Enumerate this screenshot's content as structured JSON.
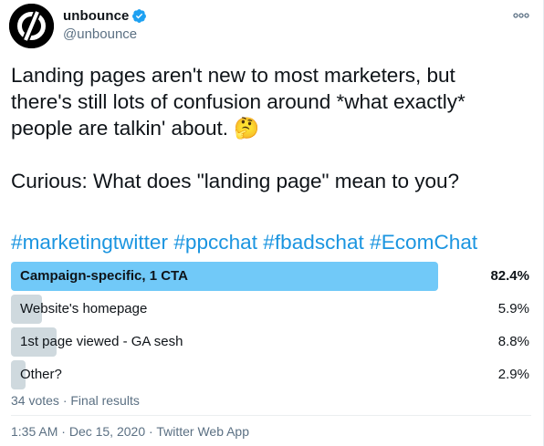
{
  "tweet": {
    "display_name": "unbounce",
    "handle": "@unbounce",
    "lines": [
      "Landing pages aren't new to most marketers, but",
      "there's still lots of confusion around *what exactly*",
      "people are talkin' about.",
      "Curious: What does \"landing page\" mean to you?"
    ],
    "emoji": "🤔",
    "hashtags": [
      "#marketingtwitter",
      "#ppcchat",
      "#fbadschat",
      "#EcomChat"
    ]
  },
  "poll": {
    "options": [
      {
        "label": "Campaign-specific, 1 CTA",
        "percent_text": "82.4%",
        "percent": 82.4,
        "winner": true
      },
      {
        "label": "Website's homepage",
        "percent_text": "5.9%",
        "percent": 5.9,
        "winner": false
      },
      {
        "label": "1st page viewed - GA sesh",
        "percent_text": "8.8%",
        "percent": 8.8,
        "winner": false
      },
      {
        "label": "Other?",
        "percent_text": "2.9%",
        "percent": 2.9,
        "winner": false
      }
    ],
    "meta": "34 votes · Final results"
  },
  "footer": {
    "time": "1:35 AM",
    "date": "Dec 15, 2020",
    "source": "Twitter Web App"
  },
  "colors": {
    "accent": "#1b95e0",
    "winner_bar": "#71c9f8",
    "other_bar": "#cfd9de",
    "verified": "#1da1f2"
  },
  "icons": {
    "avatar": "unbounce-logo-icon",
    "verified": "verified-badge-icon",
    "more": "more-options-icon"
  }
}
